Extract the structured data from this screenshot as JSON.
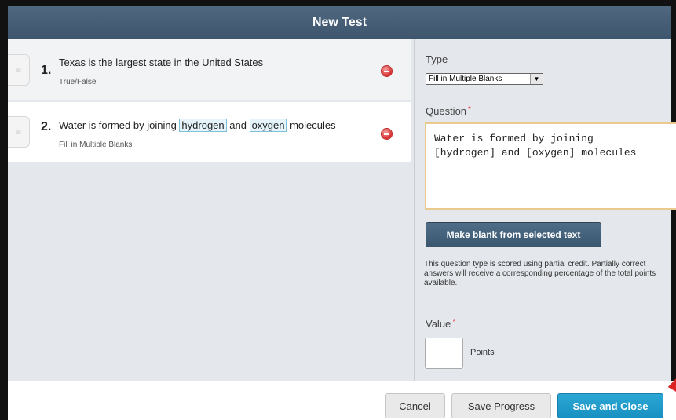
{
  "dialog": {
    "title": "New Test"
  },
  "questions": [
    {
      "number": "1.",
      "text": "Texas is the largest state in the United States",
      "type": "True/False"
    },
    {
      "number": "2.",
      "text_parts": [
        "Water is formed by joining ",
        "hydrogen",
        " and ",
        "oxygen",
        " molecules"
      ],
      "type": "Fill in Multiple Blanks"
    }
  ],
  "editor": {
    "type_label": "Type",
    "type_value": "Fill in Multiple Blanks",
    "question_label": "Question",
    "required_marker": "*",
    "question_text": "Water is formed by joining\n[hydrogen] and [oxygen] molecules",
    "make_blank_label": "Make blank from selected text",
    "scoring_note": "This question type is scored using partial credit. Partially correct answers will receive a corresponding percentage of the total points available.",
    "value_label": "Value",
    "value_input": "",
    "points_label": "Points"
  },
  "footer": {
    "cancel_label": "Cancel",
    "save_progress_label": "Save Progress",
    "save_close_label": "Save and Close"
  },
  "colors": {
    "titlebar": "#45607a",
    "primary_button": "#1f9ccb",
    "blank_highlight": "#e4f4fa",
    "remove_icon": "#d82b2b"
  }
}
